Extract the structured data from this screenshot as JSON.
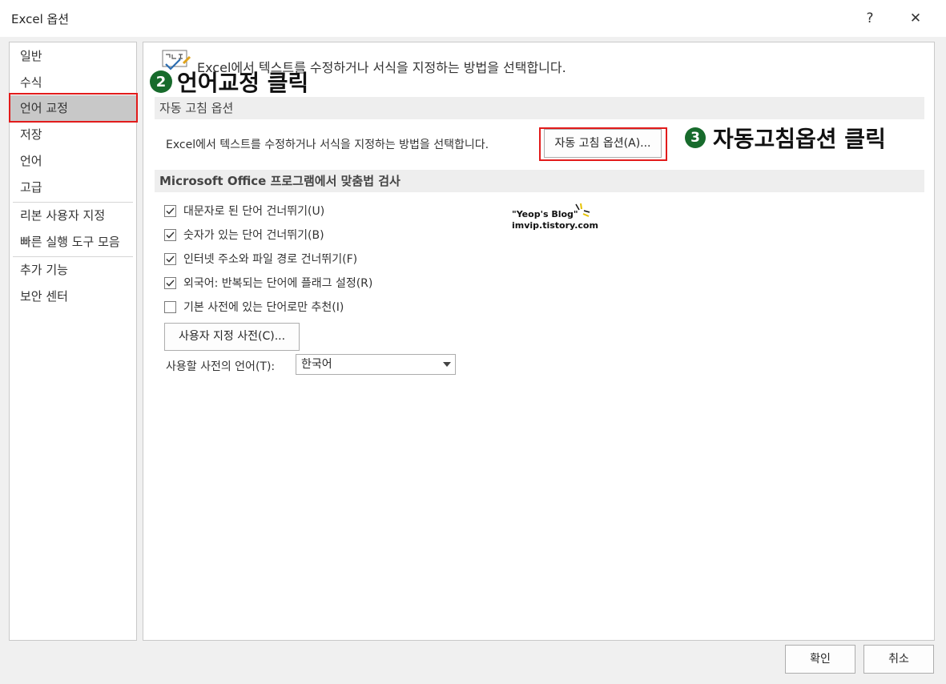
{
  "window": {
    "title": "Excel 옵션",
    "help_glyph": "?",
    "close_glyph": "✕"
  },
  "sidebar": {
    "items": [
      {
        "label": "일반"
      },
      {
        "label": "수식"
      },
      {
        "label": "언어 교정"
      },
      {
        "label": "저장"
      },
      {
        "label": "언어"
      },
      {
        "label": "고급"
      },
      {
        "label": "리본 사용자 지정"
      },
      {
        "label": "빠른 실행 도구 모음"
      },
      {
        "label": "추가 기능"
      },
      {
        "label": "보안 센터"
      }
    ],
    "selected_index": 2
  },
  "main": {
    "header_text": "Excel에서 텍스트를 수정하거나 서식을 지정하는 방법을 선택합니다.",
    "autocorrect_section": {
      "title": "자동 고침 옵션",
      "description": "Excel에서 텍스트를 수정하거나 서식을 지정하는 방법을 선택합니다.",
      "button_label": "자동 고침 옵션(A)..."
    },
    "spelling_section": {
      "title": "Microsoft Office 프로그램에서 맞춤법 검사",
      "options": [
        {
          "label": "대문자로 된 단어 건너뛰기(U)",
          "checked": true
        },
        {
          "label": "숫자가 있는 단어 건너뛰기(B)",
          "checked": true
        },
        {
          "label": "인터넷 주소와 파일 경로 건너뛰기(F)",
          "checked": true
        },
        {
          "label": "외국어: 반복되는 단어에 플래그 설정(R)",
          "checked": true
        },
        {
          "label": "기본 사전에 있는 단어로만 추천(I)",
          "checked": false
        }
      ],
      "custom_dict_button": "사용자 지정 사전(C)...",
      "dict_language_label": "사용할 사전의 언어(T):",
      "dict_language_value": "한국어"
    }
  },
  "watermark": {
    "line1": "\"Yeop's Blog\"",
    "line2": "imvip.tistory.com"
  },
  "annotations": {
    "step2": {
      "number": "2",
      "text": "언어교정 클릭"
    },
    "step3": {
      "number": "3",
      "text": "자동고침옵션 클릭"
    }
  },
  "footer": {
    "ok_label": "확인",
    "cancel_label": "취소"
  },
  "colors": {
    "highlight_border": "#e21b1b",
    "annotation_badge": "#176b2c",
    "selected_nav": "#c8c8c8"
  }
}
